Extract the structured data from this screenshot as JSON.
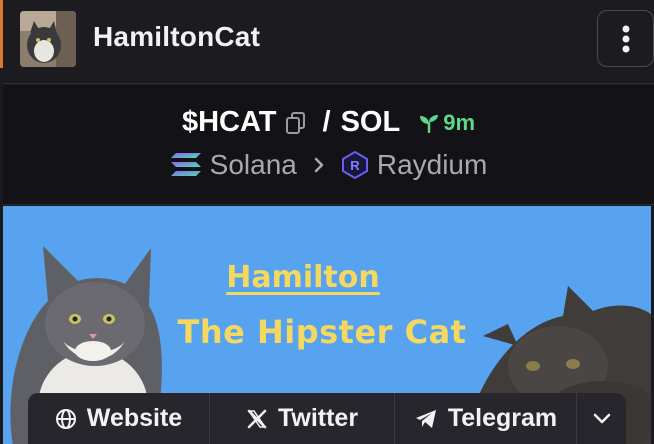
{
  "header": {
    "token_name": "HamiltonCat",
    "avatar_icon": "cat-avatar-image",
    "menu_icon": "vertical-ellipsis-icon"
  },
  "pair": {
    "symbol": "$HCAT",
    "separator": "/",
    "quote": "SOL",
    "age": "9m",
    "age_color": "#5fd68a"
  },
  "chain": {
    "network": "Solana",
    "dex": "Raydium"
  },
  "banner": {
    "title_line1": "Hamilton",
    "title_line2": "The Hipster Cat",
    "background_color": "#57a3f0",
    "text_color": "#f4d860"
  },
  "links": {
    "website": "Website",
    "twitter": "Twitter",
    "telegram": "Telegram"
  }
}
